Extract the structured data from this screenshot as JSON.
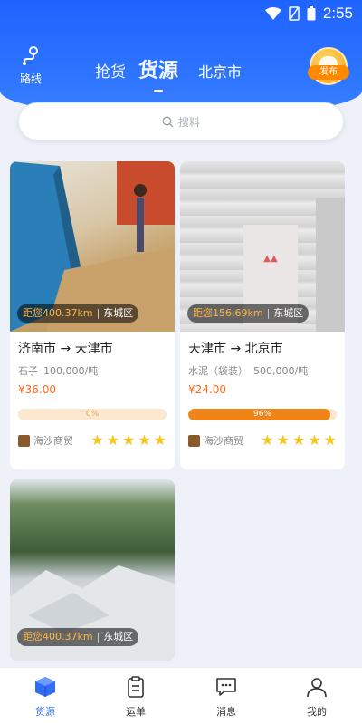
{
  "status": {
    "time": "2:55"
  },
  "header": {
    "route_label": "路线",
    "tabs": [
      {
        "label": "抢货",
        "active": false
      },
      {
        "label": "货源",
        "active": true
      }
    ],
    "city": "北京市",
    "publish_label": "发布"
  },
  "search": {
    "placeholder": "搜料"
  },
  "cards": [
    {
      "distance": "距您400.37km",
      "district": "东城区",
      "route": "济南市 → 天津市",
      "goods_name": "石子",
      "quantity": "100,000/吨",
      "price": "¥36.00",
      "progress_text": "0%",
      "progress": 0,
      "seller": "海沙商贸",
      "rating": 5
    },
    {
      "distance": "距您156.69km",
      "district": "东城区",
      "route": "天津市 → 北京市",
      "goods_name": "水泥（袋装）",
      "quantity": "500,000/吨",
      "price": "¥24.00",
      "progress_text": "96%",
      "progress": 96,
      "seller": "海沙商贸",
      "rating": 5
    },
    {
      "distance": "距您400.37km",
      "district": "东城区"
    }
  ],
  "nav": [
    {
      "label": "货源",
      "icon": "box-icon",
      "active": true
    },
    {
      "label": "运单",
      "icon": "clipboard-icon",
      "active": false
    },
    {
      "label": "消息",
      "icon": "chat-icon",
      "active": false
    },
    {
      "label": "我的",
      "icon": "user-icon",
      "active": false
    }
  ],
  "colors": {
    "primary": "#2f6df6",
    "accent": "#f08418",
    "price": "#ff6a1a",
    "star": "#f5c518"
  }
}
